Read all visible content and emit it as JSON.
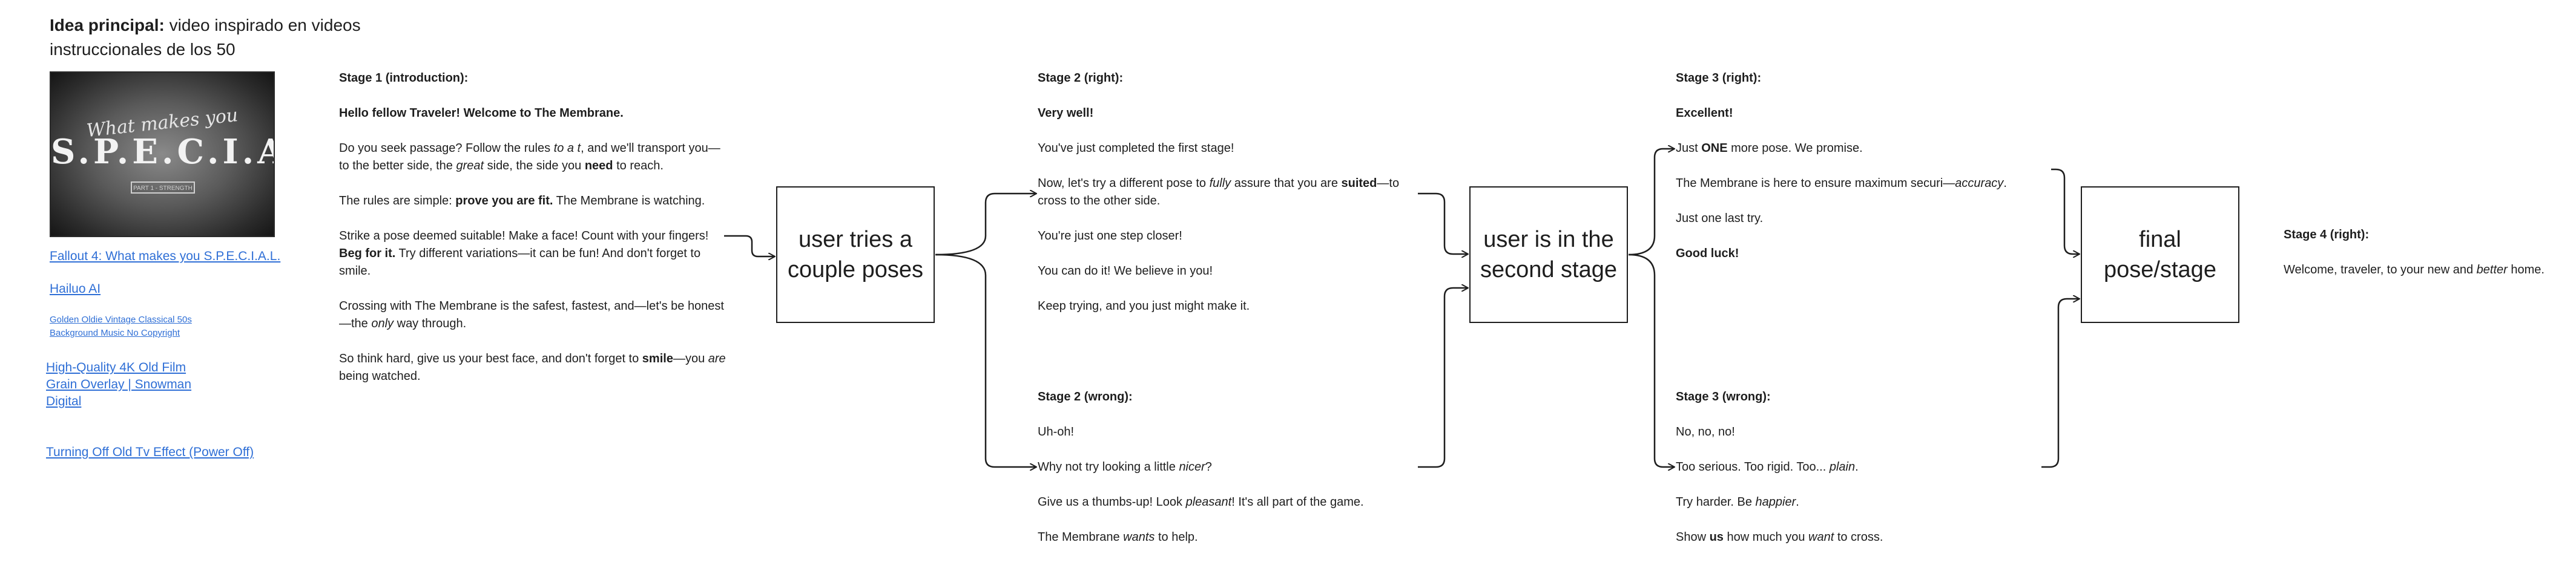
{
  "title": {
    "bold": "Idea principal:",
    "rest": " video inspirado en videos instruccionales de los 50"
  },
  "thumbnail": {
    "script_text": "What makes you",
    "big_text": "S.P.E.C.I.A.L.",
    "part_text": "PART 1 - STRENGTH"
  },
  "links": [
    "Fallout 4: What makes you S.P.E.C.I.A.L.",
    "Hailuo AI",
    "Golden Oldie Vintage Classical 50s Background Music No Copyright",
    "High-Quality 4K Old Film Grain Overlay | Snowman Digital",
    "Turning Off Old Tv Effect (Power Off)"
  ],
  "stage1": {
    "heading": "Stage 1 (introduction):",
    "greeting": "Hello fellow Traveler! Welcome to The Membrane.",
    "p1": {
      "a": "Do you seek passage? Follow the rules ",
      "i1": "to a t",
      "b": ", and we'll transport you—to the better side, the ",
      "i2": "great",
      "c": " side, the side you ",
      "strong": "need",
      "d": " to reach."
    },
    "p2": {
      "a": "The rules are simple: ",
      "strong": "prove you are fit.",
      "b": " The Membrane is watching."
    },
    "p3": {
      "a": "Strike a pose deemed suitable! Make a face! Count with your fingers! ",
      "strong": "Beg for it.",
      "b": " Try different variations—it can be fun! And don't forget to smile."
    },
    "p4": {
      "a": "Crossing with The Membrane is the safest, fastest, and—let's be honest—the ",
      "i": "only",
      "b": " way through."
    },
    "p5": {
      "a": "So think hard, give us your best face, and don't forget to ",
      "strong": "smile",
      "b": "—you ",
      "i": "are",
      "c": " being watched."
    }
  },
  "boxes": {
    "b1": "user tries a couple poses",
    "b2": "user is in the second stage",
    "b3": "final pose/stage"
  },
  "stage2_right": {
    "heading": "Stage 2 (right):",
    "l1": "Very well!",
    "l2": "You've just completed the first stage!",
    "l3": {
      "a": "Now, let's try a different pose to ",
      "i": "fully",
      "b": " assure that you are ",
      "strong": "suited",
      "c": "—to cross to the other side."
    },
    "l4": "You're just one step closer!",
    "l5": "You can do it! We believe in you!",
    "l6": "Keep trying, and you just might make it."
  },
  "stage2_wrong": {
    "heading": "Stage 2 (wrong):",
    "l1": "Uh-oh!",
    "l2": {
      "a": "Why not try looking a little ",
      "i": "nicer",
      "b": "?"
    },
    "l3": {
      "a": "Give us a thumbs-up! Look ",
      "i": "pleasant",
      "b": "! It's all part of the game."
    },
    "l4": {
      "a": "The Membrane ",
      "i": "wants",
      "b": " to help."
    }
  },
  "stage3_right": {
    "heading": "Stage 3 (right):",
    "l1": "Excellent!",
    "l2": {
      "a": "Just ",
      "strong": "ONE",
      "b": " more pose. We promise."
    },
    "l3": {
      "a": "The Membrane is here to ensure maximum securi—",
      "i": "accuracy",
      "b": "."
    },
    "l4": "Just one last try.",
    "l5": "Good luck!"
  },
  "stage3_wrong": {
    "heading": "Stage 3 (wrong):",
    "l1": "No, no, no!",
    "l2": {
      "a": "Too serious. Too rigid. Too... ",
      "i": "plain",
      "b": "."
    },
    "l3": {
      "a": "Try harder. Be ",
      "i": "happier",
      "b": "."
    },
    "l4": {
      "a": "Show ",
      "strong": "us",
      "b": " how much you ",
      "i": "want",
      "c": " to cross."
    }
  },
  "stage4": {
    "heading": "Stage 4 (right):",
    "l1": {
      "a": "Welcome, traveler, to your new and ",
      "i": "better",
      "b": " home."
    }
  },
  "colors": {
    "link": "#2f6fd6",
    "stroke": "#1e1e1e",
    "text": "#1e1e1e"
  }
}
